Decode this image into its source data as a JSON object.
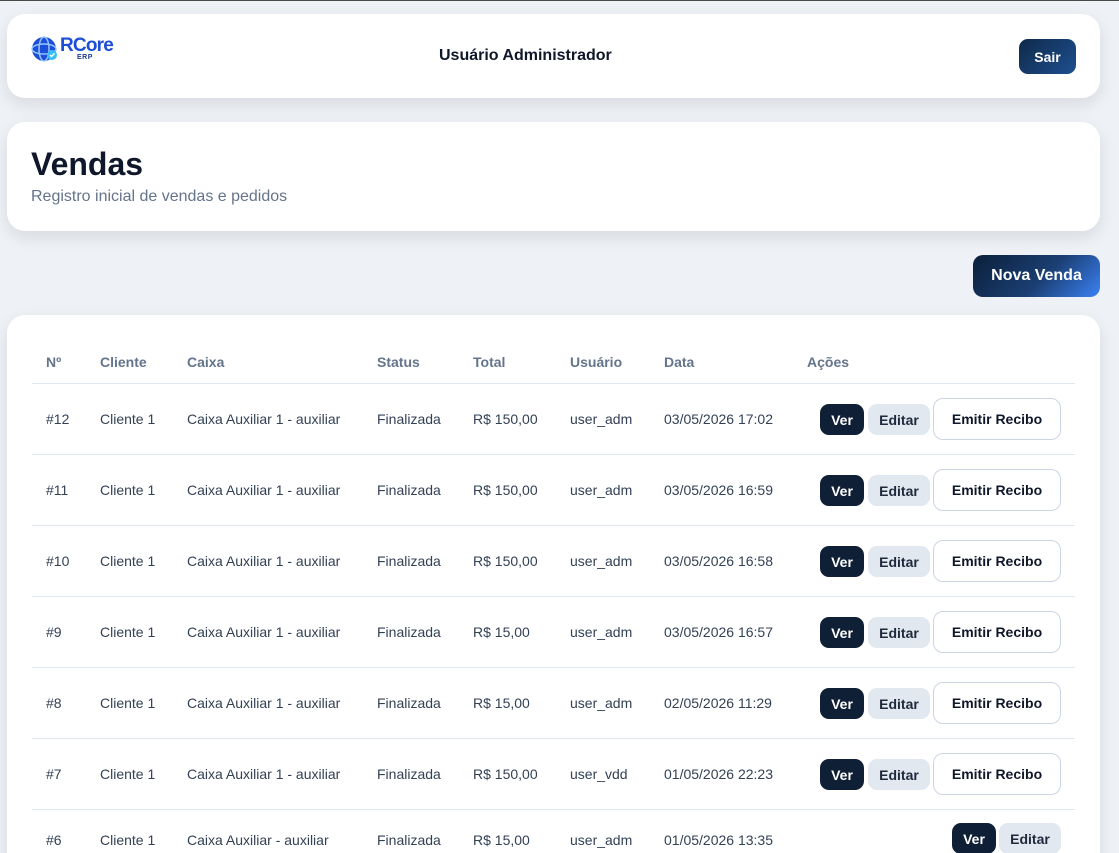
{
  "brand": {
    "logo_text": "RCore",
    "logo_sub": "ERP"
  },
  "header": {
    "user_name": "Usuário Administrador",
    "logout_label": "Sair"
  },
  "page": {
    "title": "Vendas",
    "subtitle": "Registro inicial de vendas e pedidos",
    "new_sale_label": "Nova Venda"
  },
  "table": {
    "columns": [
      "Nº",
      "Cliente",
      "Caixa",
      "Status",
      "Total",
      "Usuário",
      "Data",
      "Ações"
    ],
    "action_labels": {
      "view": "Ver",
      "edit": "Editar",
      "receipt": "Emitir Recibo"
    },
    "rows": [
      {
        "id": "#12",
        "cliente": "Cliente 1",
        "caixa": "Caixa Auxiliar 1 - auxiliar",
        "status": "Finalizada",
        "total": "R$ 150,00",
        "usuario": "user_adm",
        "data": "03/05/2026 17:02"
      },
      {
        "id": "#11",
        "cliente": "Cliente 1",
        "caixa": "Caixa Auxiliar 1 - auxiliar",
        "status": "Finalizada",
        "total": "R$ 150,00",
        "usuario": "user_adm",
        "data": "03/05/2026 16:59"
      },
      {
        "id": "#10",
        "cliente": "Cliente 1",
        "caixa": "Caixa Auxiliar 1 - auxiliar",
        "status": "Finalizada",
        "total": "R$ 150,00",
        "usuario": "user_adm",
        "data": "03/05/2026 16:58"
      },
      {
        "id": "#9",
        "cliente": "Cliente 1",
        "caixa": "Caixa Auxiliar 1 - auxiliar",
        "status": "Finalizada",
        "total": "R$ 15,00",
        "usuario": "user_adm",
        "data": "03/05/2026 16:57"
      },
      {
        "id": "#8",
        "cliente": "Cliente 1",
        "caixa": "Caixa Auxiliar 1 - auxiliar",
        "status": "Finalizada",
        "total": "R$ 15,00",
        "usuario": "user_adm",
        "data": "02/05/2026 11:29"
      },
      {
        "id": "#7",
        "cliente": "Cliente 1",
        "caixa": "Caixa Auxiliar 1 - auxiliar",
        "status": "Finalizada",
        "total": "R$ 150,00",
        "usuario": "user_vdd",
        "data": "01/05/2026 22:23"
      },
      {
        "id": "#6",
        "cliente": "Cliente 1",
        "caixa": "Caixa Auxiliar - auxiliar",
        "status": "Finalizada",
        "total": "R$ 15,00",
        "usuario": "user_adm",
        "data": "01/05/2026 13:35"
      }
    ]
  }
}
